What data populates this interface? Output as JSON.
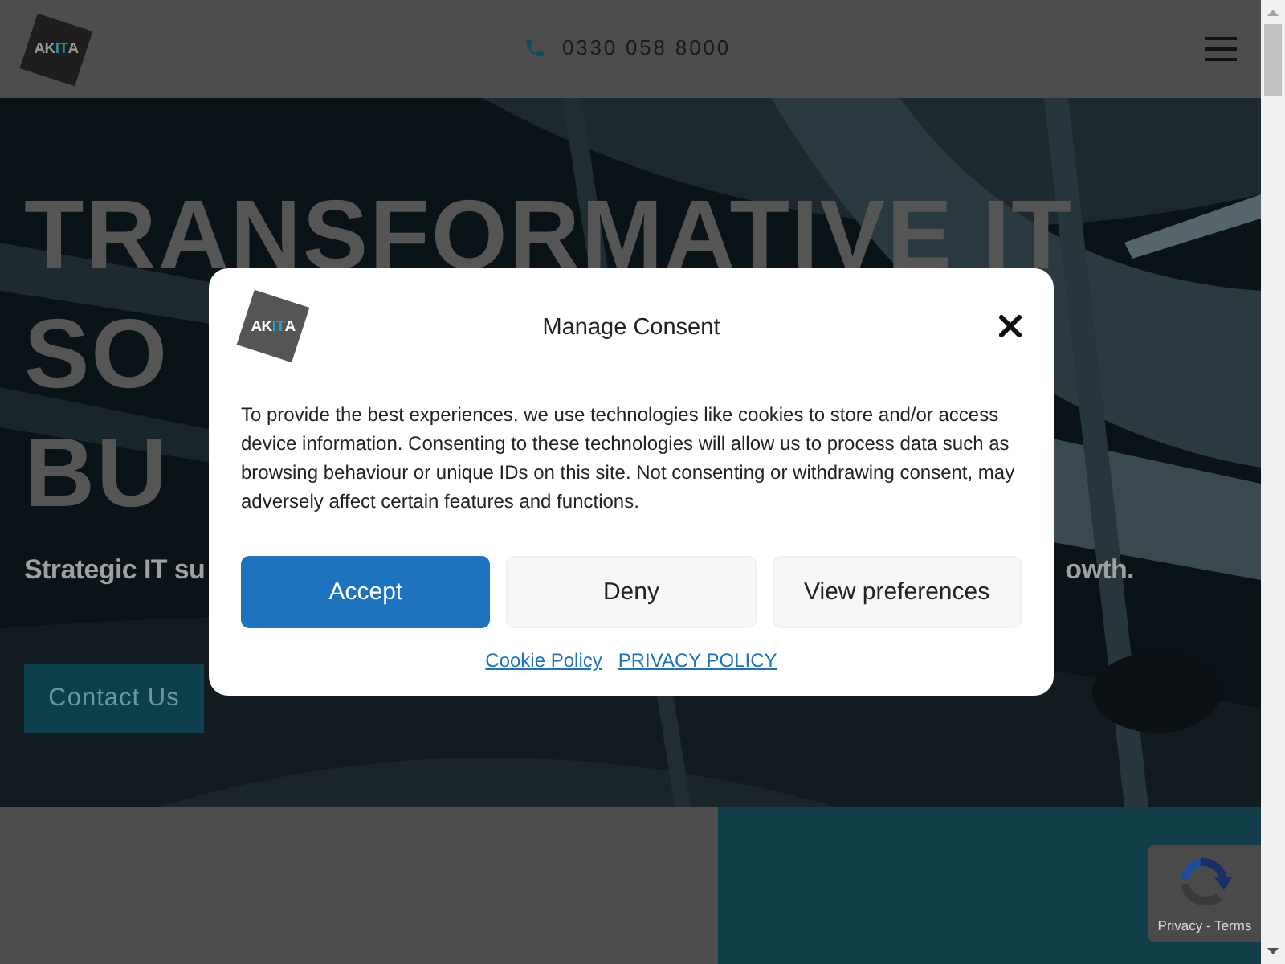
{
  "header": {
    "logo": [
      {
        "text": "AK",
        "accent": false
      },
      {
        "text": "IT",
        "accent": true
      },
      {
        "text": "A",
        "accent": false
      }
    ],
    "phone": "0330 058 8000"
  },
  "hero": {
    "heading_lines": [
      "TRANSFORMATIVE IT",
      "SO",
      "BU"
    ],
    "subtitle_parts": [
      "Strategic IT su",
      "owth."
    ],
    "button": "Contact Us"
  },
  "consent": {
    "logo": [
      {
        "text": "AK",
        "accent": false
      },
      {
        "text": "IT",
        "accent": true
      },
      {
        "text": "A",
        "accent": false
      }
    ],
    "title": "Manage Consent",
    "body": "To provide the best experiences, we use technologies like cookies to store and/or access device information. Consenting to these technologies will allow us to process data such as browsing behaviour or unique IDs on this site. Not consenting or withdrawing consent, may adversely affect certain features and functions.",
    "buttons": [
      {
        "label": "Accept",
        "primary": true
      },
      {
        "label": "Deny",
        "primary": false
      },
      {
        "label": "View preferences",
        "primary": false
      }
    ],
    "links": [
      "Cookie Policy",
      "PRIVACY POLICY"
    ]
  },
  "recaptcha": {
    "links": "Privacy - Terms"
  }
}
